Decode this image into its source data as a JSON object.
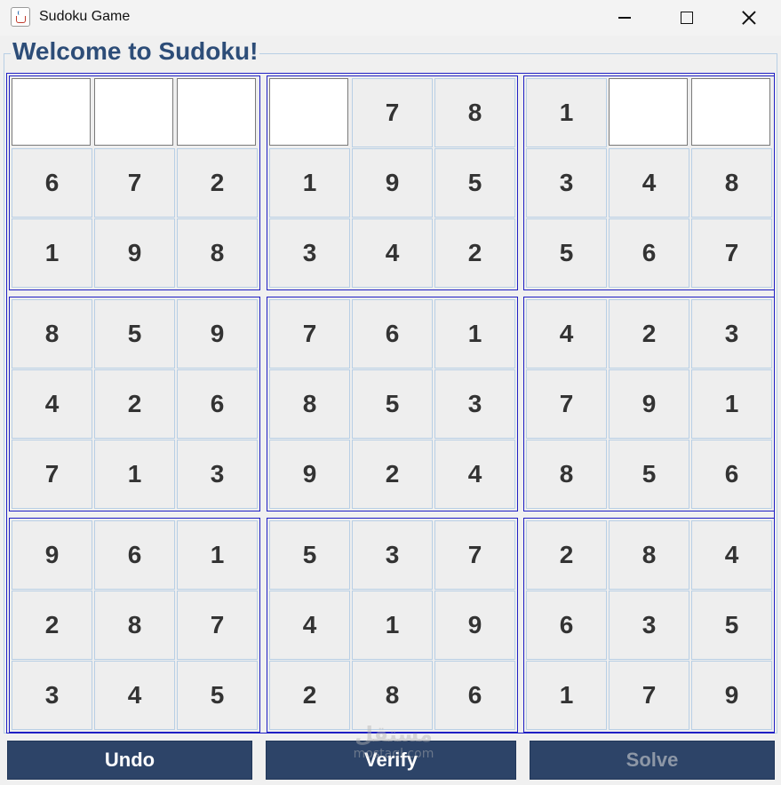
{
  "window": {
    "title": "Sudoku Game",
    "icon": "java-cup-icon",
    "controls": [
      "minimize-icon",
      "maximize-icon",
      "close-icon"
    ]
  },
  "header": {
    "title": "Welcome to Sudoku!"
  },
  "colors": {
    "title_text": "#2d4d78",
    "box_border": "#1f1fc4",
    "cell_border": "#b8cfe5",
    "cell_bg": "#eeeeee",
    "digit": "#333333",
    "button_bg": "#2d4468",
    "button_text": "#ffffff",
    "button_disabled_text": "#8d97a6"
  },
  "grid": [
    [
      "",
      "",
      "",
      "",
      "7",
      "8",
      "1",
      "",
      ""
    ],
    [
      "6",
      "7",
      "2",
      "1",
      "9",
      "5",
      "3",
      "4",
      "8"
    ],
    [
      "1",
      "9",
      "8",
      "3",
      "4",
      "2",
      "5",
      "6",
      "7"
    ],
    [
      "8",
      "5",
      "9",
      "7",
      "6",
      "1",
      "4",
      "2",
      "3"
    ],
    [
      "4",
      "2",
      "6",
      "8",
      "5",
      "3",
      "7",
      "9",
      "1"
    ],
    [
      "7",
      "1",
      "3",
      "9",
      "2",
      "4",
      "8",
      "5",
      "6"
    ],
    [
      "9",
      "6",
      "1",
      "5",
      "3",
      "7",
      "2",
      "8",
      "4"
    ],
    [
      "2",
      "8",
      "7",
      "4",
      "1",
      "9",
      "6",
      "3",
      "5"
    ],
    [
      "3",
      "4",
      "5",
      "2",
      "8",
      "6",
      "1",
      "7",
      "9"
    ]
  ],
  "buttons": {
    "undo": "Undo",
    "verify": "Verify",
    "solve": "Solve",
    "solve_enabled": false
  },
  "watermark": {
    "arabic": "مستقل",
    "latin": "mostaql.com"
  }
}
